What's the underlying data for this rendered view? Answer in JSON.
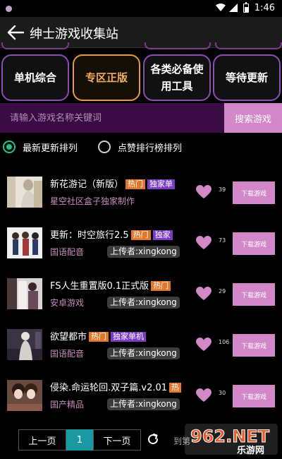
{
  "status_bar": {
    "time": "1:46"
  },
  "header": {
    "title": "绅士游戏收集站"
  },
  "categories": [
    {
      "label": "单机综合",
      "active": false
    },
    {
      "label": "专区正版",
      "active": true
    },
    {
      "label": "各类必备使用工具",
      "active": false
    },
    {
      "label": "等待更新",
      "active": false
    }
  ],
  "search": {
    "placeholder": "请输入游戏名称关键词",
    "button_label": "搜索游戏"
  },
  "sort": {
    "latest_label": "最新更新排列",
    "likes_label": "点赞排行榜排列",
    "selected": "latest"
  },
  "games": [
    {
      "title": "新花游记（新版）",
      "tags": [
        "热门",
        "独家单"
      ],
      "subtitle": "星空社区盒子独家制作",
      "uploader": "",
      "likes": "39",
      "download_label": "下载游戏"
    },
    {
      "title": "更新：时空旅行2.5",
      "tags": [
        "热门",
        "独家"
      ],
      "subtitle": "国语配音",
      "uploader": "上传者:xingkong",
      "likes": "73",
      "download_label": "下载游戏"
    },
    {
      "title": "FS人生重置版0.1正式版",
      "tags": [
        "热门"
      ],
      "subtitle": "安卓游戏",
      "uploader": "上传者:xingkong",
      "likes": "29",
      "download_label": "下载游戏"
    },
    {
      "title": "欲望都市",
      "tags": [
        "热门",
        "独家单机"
      ],
      "subtitle": "国语配音",
      "uploader": "上传者:xingkong",
      "likes": "106",
      "download_label": "下载游戏"
    },
    {
      "title": "侵染.命运轮回.双子篇.v2.01",
      "tags": [
        "热"
      ],
      "subtitle": "国产精品",
      "uploader": "上传者:xingkong",
      "likes": "30",
      "download_label": "下载游戏"
    }
  ],
  "pagination": {
    "prev_label": "上一页",
    "current_page": "1",
    "next_label": "下一页",
    "jump_label": "到第"
  },
  "watermark": {
    "text": "962.NET",
    "subtext": "乐游网"
  },
  "colors": {
    "accent_pink": "#d287c8",
    "tab_border": "#8b4db5",
    "active_tab": "#e89a3a",
    "search_bg": "#3a0b45",
    "hot_tag": "#e2762a",
    "exclusive_tag": "#7b3bc4",
    "radio_on": "#22c28a",
    "page_current": "#1a9aa0"
  }
}
